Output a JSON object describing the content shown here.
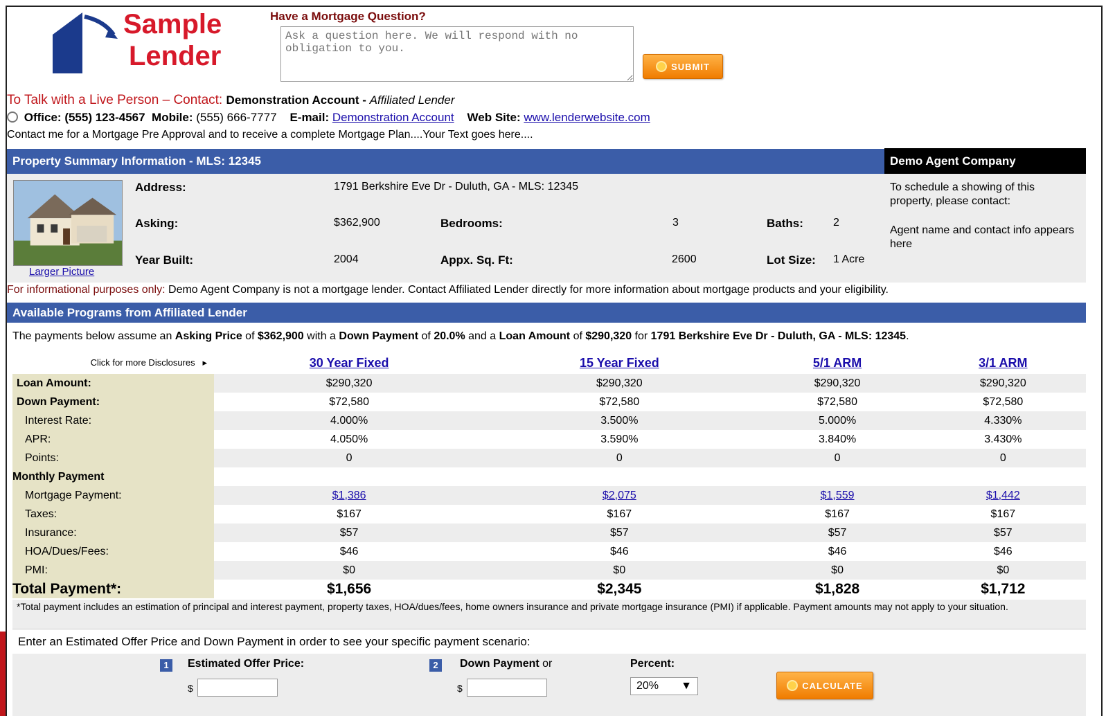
{
  "brand": {
    "name_line1": "Sample",
    "name_line2": "Lender",
    "color": "#d7192a",
    "house_color": "#1b3a8c"
  },
  "question": {
    "title": "Have a Mortgage Question?",
    "placeholder": "Ask a question here. We will respond with no obligation to you.",
    "submit_label": "SUBMIT"
  },
  "contact": {
    "talk_prefix": "To Talk with a Live Person – Contact:",
    "name": "Demonstration Account",
    "dash": " - ",
    "role": "Affiliated Lender",
    "office_label": "Office:",
    "office": "(555) 123-4567",
    "mobile_label": "Mobile:",
    "mobile": "(555) 666-7777",
    "email_label": "E-mail:",
    "email_link": "Demonstration Account",
    "web_label": "Web Site:",
    "web_link": "www.lenderwebsite.com",
    "promo": "Contact me for a Mortgage Pre Approval and to receive a complete Mortgage Plan....Your Text goes here...."
  },
  "property": {
    "bar_title": "Property Summary Information - MLS: 12345",
    "address_label": "Address:",
    "address": "1791 Berkshire Eve Dr - Duluth, GA - MLS: 12345",
    "asking_label": "Asking:",
    "asking": "$362,900",
    "bedrooms_label": "Bedrooms:",
    "bedrooms": "3",
    "baths_label": "Baths:",
    "baths": "2",
    "year_label": "Year Built:",
    "year": "2004",
    "sqft_label": "Appx. Sq. Ft:",
    "sqft": "2600",
    "lot_label": "Lot Size:",
    "lot": "1 Acre",
    "larger_picture": "Larger Picture"
  },
  "agent": {
    "company": "Demo Agent Company",
    "schedule_text": "To schedule a showing of this property, please contact:",
    "agent_info": "Agent name and contact info appears here"
  },
  "disclaimer": {
    "bold": "For informational purposes only:",
    "text": " Demo Agent Company is not a mortgage lender. Contact Affiliated Lender directly for more information about mortgage products and your eligibility."
  },
  "programs": {
    "bar_title": "Available Programs from Affiliated Lender",
    "assume_1": "The payments below assume an ",
    "assume_asking_lbl": "Asking Price",
    "assume_2": " of ",
    "assume_price": "$362,900",
    "assume_3": " with a ",
    "assume_dp_lbl": "Down Payment",
    "assume_4": " of ",
    "assume_dp": "20.0%",
    "assume_5": " and a ",
    "assume_loan_lbl": "Loan Amount",
    "assume_6": " of ",
    "assume_loan": "$290,320",
    "assume_7": " for ",
    "assume_addr": "1791 Berkshire Eve Dr - Duluth, GA - MLS: 12345",
    "assume_8": ".",
    "disclosures": "Click for more Disclosures",
    "columns": [
      "30 Year Fixed",
      "15 Year Fixed",
      "5/1 ARM",
      "3/1 ARM"
    ],
    "rows": {
      "loan_amount": {
        "label": "Loan Amount:",
        "values": [
          "$290,320",
          "$290,320",
          "$290,320",
          "$290,320"
        ]
      },
      "down_payment": {
        "label": "Down Payment:",
        "values": [
          "$72,580",
          "$72,580",
          "$72,580",
          "$72,580"
        ]
      },
      "interest_rate": {
        "label": "Interest Rate:",
        "values": [
          "4.000%",
          "3.500%",
          "5.000%",
          "4.330%"
        ]
      },
      "apr": {
        "label": "APR:",
        "values": [
          "4.050%",
          "3.590%",
          "3.840%",
          "3.430%"
        ]
      },
      "points": {
        "label": "Points:",
        "values": [
          "0",
          "0",
          "0",
          "0"
        ]
      },
      "monthly": {
        "label": "Monthly Payment"
      },
      "mortgage_payment": {
        "label": "Mortgage Payment:",
        "values": [
          "$1,386",
          "$2,075",
          "$1,559",
          "$1,442"
        ]
      },
      "taxes": {
        "label": "Taxes:",
        "values": [
          "$167",
          "$167",
          "$167",
          "$167"
        ]
      },
      "insurance": {
        "label": "Insurance:",
        "values": [
          "$57",
          "$57",
          "$57",
          "$57"
        ]
      },
      "hoa": {
        "label": "HOA/Dues/Fees:",
        "values": [
          "$46",
          "$46",
          "$46",
          "$46"
        ]
      },
      "pmi": {
        "label": "PMI:",
        "values": [
          "$0",
          "$0",
          "$0",
          "$0"
        ]
      },
      "total": {
        "label": "Total Payment*:",
        "values": [
          "$1,656",
          "$2,345",
          "$1,828",
          "$1,712"
        ]
      }
    },
    "footnote": "*Total payment includes an estimation of principal and interest payment, property taxes, HOA/dues/fees, home owners insurance and private mortgage insurance (PMI) if applicable. Payment amounts may not apply to your situation."
  },
  "calculator": {
    "intro": "Enter an Estimated Offer Price and Down Payment in order to see your specific payment scenario:",
    "step1": "1",
    "offer_label": "Estimated Offer Price:",
    "step2": "2",
    "down_label": "Down Payment",
    "or": "or",
    "percent_label": "Percent:",
    "currency": "$",
    "percent_value": "20%",
    "calc_label": "CALCULATE"
  }
}
